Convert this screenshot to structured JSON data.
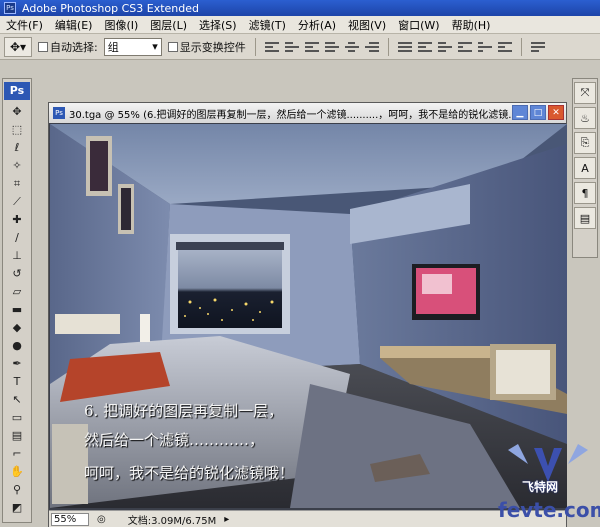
{
  "app": {
    "title": "Adobe Photoshop CS3 Extended"
  },
  "menu": [
    "文件(F)",
    "编辑(E)",
    "图像(I)",
    "图层(L)",
    "选择(S)",
    "滤镜(T)",
    "分析(A)",
    "视图(V)",
    "窗口(W)",
    "帮助(H)"
  ],
  "options": {
    "auto_select_label": "自动选择:",
    "auto_select_value": "组",
    "show_transform_label": "显示变换控件"
  },
  "toolbox": {
    "badge": "Ps"
  },
  "document": {
    "title": "30.tga @ 55% (6.把调好的图层再复制一层，然后给一个滤镜..........，呵呵，我不是给的锐化滤镜...",
    "caption": [
      "6. 把调好的图层再复制一层，",
      "然后给一个滤镜…………，",
      "呵呵，我不是给的锐化滤镜哦！"
    ],
    "zoom": "55%",
    "doc_info": "文档:3.09M/6.75M"
  },
  "watermark": {
    "site": "fevte.com",
    "brand": "飞特网"
  }
}
